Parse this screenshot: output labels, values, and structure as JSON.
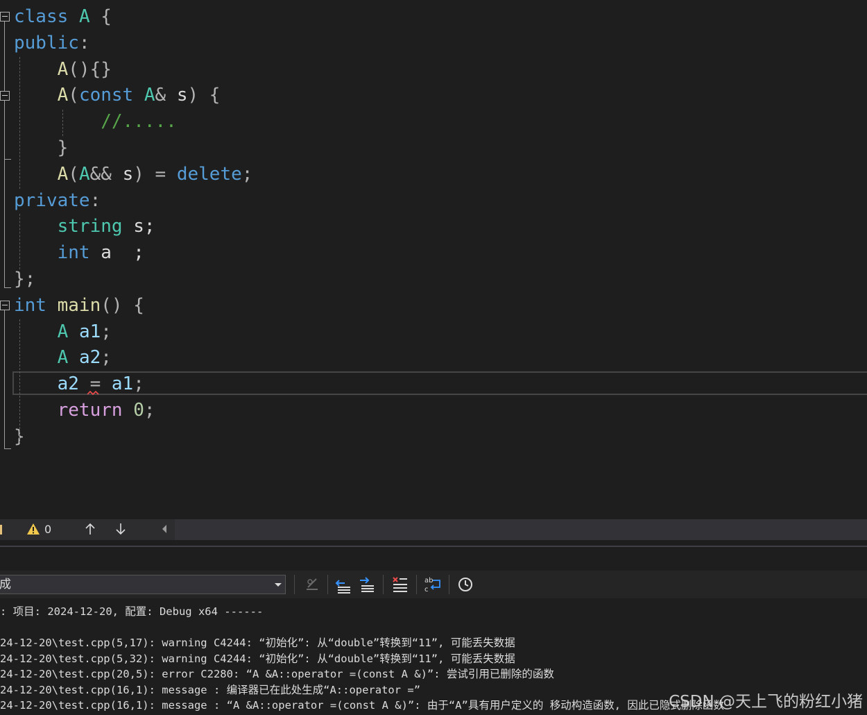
{
  "editor": {
    "lines": [
      [
        {
          "t": "class",
          "c": "kw"
        },
        {
          "t": " ",
          "c": "plain"
        },
        {
          "t": "A",
          "c": "type"
        },
        {
          "t": " {",
          "c": "op"
        }
      ],
      [
        {
          "t": "public",
          "c": "kw"
        },
        {
          "t": ":",
          "c": "op"
        }
      ],
      [
        {
          "t": "    ",
          "c": "plain"
        },
        {
          "t": "A",
          "c": "fn"
        },
        {
          "t": "(){}",
          "c": "op"
        }
      ],
      [
        {
          "t": "    ",
          "c": "plain"
        },
        {
          "t": "A",
          "c": "fn"
        },
        {
          "t": "(",
          "c": "op"
        },
        {
          "t": "const",
          "c": "kw"
        },
        {
          "t": " ",
          "c": "plain"
        },
        {
          "t": "A",
          "c": "type"
        },
        {
          "t": "& ",
          "c": "op"
        },
        {
          "t": "s",
          "c": "plain"
        },
        {
          "t": ") {",
          "c": "op"
        }
      ],
      [
        {
          "t": "        ",
          "c": "plain"
        },
        {
          "t": "//.....",
          "c": "cmt"
        }
      ],
      [
        {
          "t": "    ",
          "c": "plain"
        },
        {
          "t": "}",
          "c": "op"
        }
      ],
      [
        {
          "t": "    ",
          "c": "plain"
        },
        {
          "t": "A",
          "c": "fn"
        },
        {
          "t": "(",
          "c": "op"
        },
        {
          "t": "A",
          "c": "type"
        },
        {
          "t": "&& ",
          "c": "op"
        },
        {
          "t": "s",
          "c": "plain"
        },
        {
          "t": ") = ",
          "c": "op"
        },
        {
          "t": "delete",
          "c": "kw"
        },
        {
          "t": ";",
          "c": "op"
        }
      ],
      [
        {
          "t": "private",
          "c": "kw"
        },
        {
          "t": ":",
          "c": "op"
        }
      ],
      [
        {
          "t": "    ",
          "c": "plain"
        },
        {
          "t": "string",
          "c": "type"
        },
        {
          "t": " s;",
          "c": "plain"
        }
      ],
      [
        {
          "t": "    ",
          "c": "plain"
        },
        {
          "t": "int",
          "c": "kw"
        },
        {
          "t": " a  ;",
          "c": "plain"
        }
      ],
      [
        {
          "t": "};",
          "c": "op"
        }
      ],
      [
        {
          "t": "int",
          "c": "kw"
        },
        {
          "t": " ",
          "c": "plain"
        },
        {
          "t": "main",
          "c": "fn"
        },
        {
          "t": "() {",
          "c": "op"
        }
      ],
      [
        {
          "t": "    ",
          "c": "plain"
        },
        {
          "t": "A",
          "c": "type"
        },
        {
          "t": " ",
          "c": "plain"
        },
        {
          "t": "a1",
          "c": "id"
        },
        {
          "t": ";",
          "c": "op"
        }
      ],
      [
        {
          "t": "    ",
          "c": "plain"
        },
        {
          "t": "A",
          "c": "type"
        },
        {
          "t": " ",
          "c": "plain"
        },
        {
          "t": "a2",
          "c": "id"
        },
        {
          "t": ";",
          "c": "op"
        }
      ],
      [
        {
          "t": "    ",
          "c": "plain"
        },
        {
          "t": "a2",
          "c": "id"
        },
        {
          "t": " = ",
          "c": "op"
        },
        {
          "t": "a1",
          "c": "id"
        },
        {
          "t": ";",
          "c": "op"
        }
      ],
      [
        {
          "t": "    ",
          "c": "plain"
        },
        {
          "t": "return",
          "c": "ctl"
        },
        {
          "t": " ",
          "c": "plain"
        },
        {
          "t": "0",
          "c": "num"
        },
        {
          "t": ";",
          "c": "op"
        }
      ],
      [
        {
          "t": "}",
          "c": "op"
        }
      ]
    ],
    "colors": {
      "kw": "#569cd6",
      "type": "#4ec9b0",
      "fn": "#dcdcaa",
      "ctl": "#d8a0df",
      "num": "#b5cea8",
      "cmt": "#57a64a",
      "id": "#9cdcfe",
      "op": "#b4b4b4",
      "plain": "#dcdcdc"
    }
  },
  "status_bar": {
    "warning_count": "0",
    "icons": [
      "warning-icon",
      "arrow-up-icon",
      "arrow-down-icon",
      "scroll-left-icon"
    ]
  },
  "output": {
    "source_value": "成",
    "toolbar_icons": [
      "find-message-icon",
      "go-previous-message-icon",
      "go-next-message-icon",
      "clear-all-icon",
      "toggle-word-wrap-icon",
      "show-timestamps-icon"
    ],
    "lines": [
      ": 项目: 2024-12-20, 配置: Debug x64 ------",
      "",
      "24-12-20\\test.cpp(5,17): warning C4244: “初始化”: 从“double”转换到“11”, 可能丢失数据",
      "24-12-20\\test.cpp(5,32): warning C4244: “初始化”: 从“double”转换到“11”, 可能丢失数据",
      "24-12-20\\test.cpp(20,5): error C2280: “A &A::operator =(const A &)”: 尝试引用已删除的函数",
      "24-12-20\\test.cpp(16,1): message : 编译器已在此处生成“A::operator =”",
      "24-12-20\\test.cpp(16,1): message : “A &A::operator =(const A &)”: 由于“A”具有用户定义的 移动构造函数, 因此已隐式删除函数"
    ]
  },
  "watermark": "CSDN @天上飞的粉红小猪"
}
